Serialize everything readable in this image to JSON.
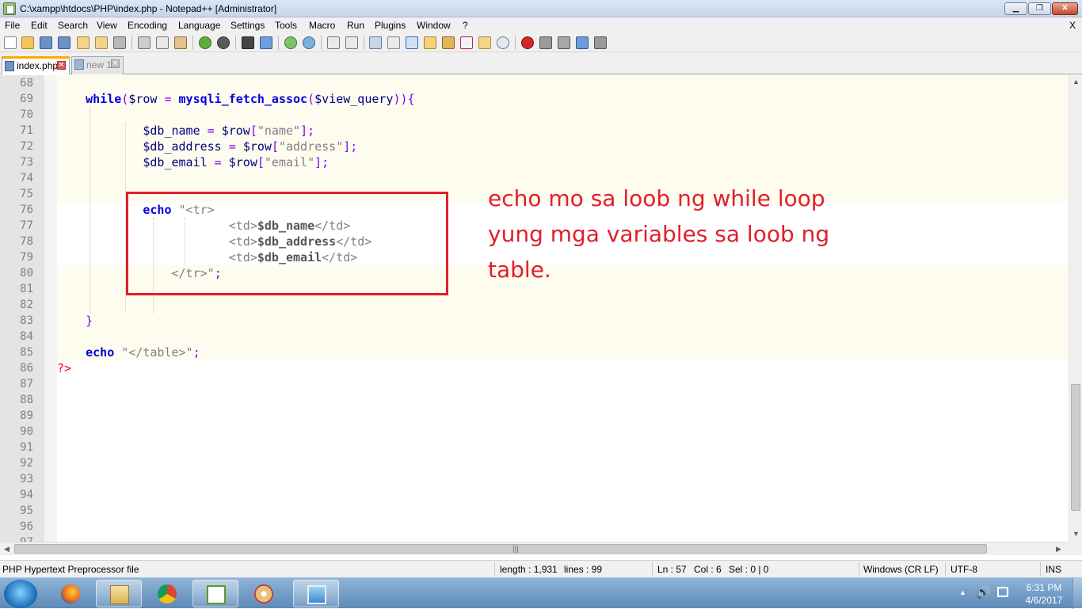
{
  "window": {
    "title": "C:\\xampp\\htdocs\\PHP\\index.php - Notepad++ [Administrator]",
    "min_label": "▁",
    "max_label": "❐",
    "close_label": "✕"
  },
  "menu": {
    "items": [
      "File",
      "Edit",
      "Search",
      "View",
      "Encoding",
      "Language",
      "Settings",
      "Tools",
      "Macro",
      "Run",
      "Plugins",
      "Window",
      "?"
    ],
    "close_x": "X"
  },
  "toolbar": {
    "icons": [
      "new-file-icon",
      "open-file-icon",
      "save-icon",
      "save-all-icon",
      "close-icon",
      "close-all-icon",
      "print-icon",
      "cut-icon",
      "copy-icon",
      "paste-icon",
      "undo-icon",
      "redo-icon",
      "find-icon",
      "replace-icon",
      "zoom-in-icon",
      "zoom-out-icon",
      "sync-vertical-icon",
      "sync-horizontal-icon",
      "word-wrap-icon",
      "show-all-chars-icon",
      "indent-guide-icon",
      "user-language-icon",
      "doc-map-icon",
      "function-list-icon",
      "folder-workspace-icon",
      "monitor-icon",
      "record-macro-icon",
      "stop-macro-icon",
      "play-macro-icon",
      "run-macro-multiple-icon",
      "save-macro-icon"
    ]
  },
  "tabs": [
    {
      "label": "index.php",
      "active": true
    },
    {
      "label": "new 1",
      "active": false
    }
  ],
  "editor": {
    "line_numbers": [
      "68",
      "69",
      "70",
      "71",
      "72",
      "73",
      "74",
      "75",
      "76",
      "77",
      "78",
      "79",
      "80",
      "81",
      "82",
      "83",
      "84",
      "85",
      "86",
      "87",
      "88",
      "89",
      "90",
      "91",
      "92",
      "93",
      "94",
      "95",
      "96",
      "97"
    ],
    "code": {
      "l69_kw": "while",
      "l69_p1": "(",
      "l69_v1": "$row",
      "l69_op": " = ",
      "l69_fn": "mysqli_fetch_assoc",
      "l69_p2": "(",
      "l69_v2": "$view_query",
      "l69_p3": ")){",
      "l71_v": "$db_name",
      "l71_op": " = ",
      "l71_v2": "$row",
      "l71_p": "[",
      "l71_s": "\"name\"",
      "l71_e": "];",
      "l72_v": "$db_address",
      "l72_op": " = ",
      "l72_v2": "$row",
      "l72_p": "[",
      "l72_s": "\"address\"",
      "l72_e": "];",
      "l73_v": "$db_email",
      "l73_op": " = ",
      "l73_v2": "$row",
      "l73_p": "[",
      "l73_s": "\"email\"",
      "l73_e": "];",
      "l76_kw": "echo",
      "l76_s": " \"<tr>",
      "l77_s1": "<td>",
      "l77_v": "$db_name",
      "l77_s2": "</td>",
      "l78_s1": "<td>",
      "l78_v": "$db_address",
      "l78_s2": "</td>",
      "l79_s1": "<td>",
      "l79_v": "$db_email",
      "l79_s2": "</td>",
      "l80_s": "</tr>\"",
      "l80_e": ";",
      "l83_p": "}",
      "l85_kw": "echo",
      "l85_s": " \"</table>\"",
      "l85_e": ";",
      "l86_ph": "?>"
    }
  },
  "annotation": {
    "text": "echo mo sa loob ng while loop yung mga variables sa loob ng table.",
    "color": "#e0202a"
  },
  "status": {
    "file_type": "PHP Hypertext Preprocessor file",
    "length": "length : 1,931",
    "lines": "lines : 99",
    "ln": "Ln : 57",
    "col": "Col : 6",
    "sel": "Sel : 0 | 0",
    "eol": "Windows (CR LF)",
    "encoding": "UTF-8",
    "mode": "INS"
  },
  "taskbar": {
    "apps": [
      "explorer-icon",
      "firefox-icon",
      "file-manager-icon",
      "chrome-icon",
      "notepadpp-icon",
      "paint-icon",
      "image-viewer-icon"
    ],
    "time": "6:31 PM",
    "date": "4/6/2017"
  }
}
